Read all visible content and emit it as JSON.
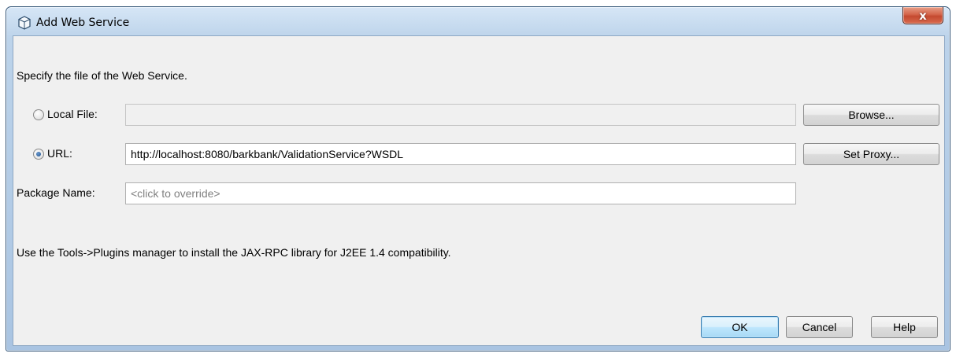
{
  "window": {
    "title": "Add Web Service",
    "close_label": "x"
  },
  "instructions": "Specify the file of the Web Service.",
  "local_file": {
    "label": "Local File:",
    "selected": false,
    "value": "",
    "browse_label": "Browse..."
  },
  "url": {
    "label": "URL:",
    "selected": true,
    "value": "http://localhost:8080/barkbank/ValidationService?WSDL",
    "proxy_label": "Set Proxy..."
  },
  "package_name": {
    "label": "Package Name:",
    "placeholder": "<click to override>"
  },
  "info": "Use the Tools->Plugins manager to install the JAX-RPC library for J2EE 1.4 compatibility.",
  "footer": {
    "ok_label": "OK",
    "cancel_label": "Cancel",
    "help_label": "Help"
  },
  "icons": {
    "title": "netbeans-cube-icon",
    "close": "close-icon"
  }
}
